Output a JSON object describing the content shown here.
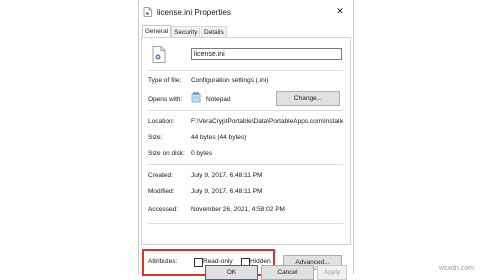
{
  "window": {
    "title": "license.ini Properties",
    "close_icon": "close-icon"
  },
  "tabs": [
    "General",
    "Security",
    "Details"
  ],
  "file_name": "license.ini",
  "type_of_file": {
    "label": "Type of file:",
    "value": "Configuration settings (.ini)"
  },
  "opens_with": {
    "label": "Opens with:",
    "value": "Notepad",
    "change_button": "Change..."
  },
  "location": {
    "label": "Location:",
    "value": "F:\\VeraCryptPortable\\Data\\PortableApps.com\\Installe"
  },
  "size": {
    "label": "Size:",
    "value": "44 bytes (44 bytes)"
  },
  "size_on_disk": {
    "label": "Size on disk:",
    "value": "0 bytes"
  },
  "created": {
    "label": "Created:",
    "value": "July 9, 2017, 6:48:11 PM"
  },
  "modified": {
    "label": "Modified:",
    "value": "July 9, 2017, 6:48:11 PM"
  },
  "accessed": {
    "label": "Accessed:",
    "value": "November 26, 2021, 4:58:02 PM"
  },
  "attributes": {
    "label": "Attributes:",
    "read_only": "Read-only",
    "hidden": "Hidden",
    "advanced_button": "Advanced...",
    "read_only_checked": false,
    "hidden_checked": false
  },
  "footer": {
    "ok": "OK",
    "cancel": "Cancel",
    "apply": "Apply"
  },
  "watermark": "wsxdn.com",
  "colors": {
    "highlight": "#e0302c"
  }
}
